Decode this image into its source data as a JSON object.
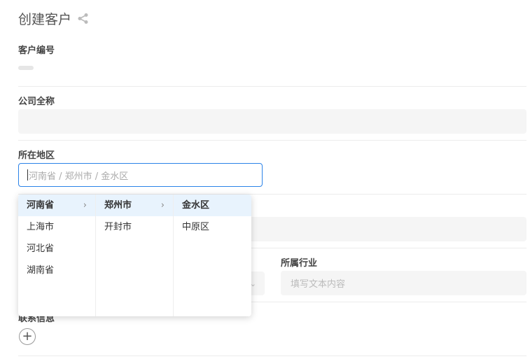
{
  "header": {
    "title": "创建客户"
  },
  "form": {
    "customer_no": {
      "label": "客户编号"
    },
    "company_name": {
      "label": "公司全称"
    },
    "region": {
      "label": "所在地区",
      "placeholder": "河南省 / 郑州市 / 金水区"
    },
    "industry": {
      "label": "所属行业",
      "placeholder": "填写文本内容"
    },
    "contacts": {
      "label": "联系信息"
    }
  },
  "cascader": {
    "provinces": [
      "河南省",
      "上海市",
      "河北省",
      "湖南省"
    ],
    "cities": [
      "郑州市",
      "开封市"
    ],
    "districts": [
      "金水区",
      "中原区"
    ],
    "expand_glyph": "›"
  },
  "icons": {
    "share": "share-icon",
    "add": "plus-circle-icon",
    "select_arrow": "chevron-down-icon"
  },
  "colors": {
    "accent": "#2b83e8",
    "active_bg": "#e8f3fd",
    "field_bg": "#f5f5f5"
  }
}
